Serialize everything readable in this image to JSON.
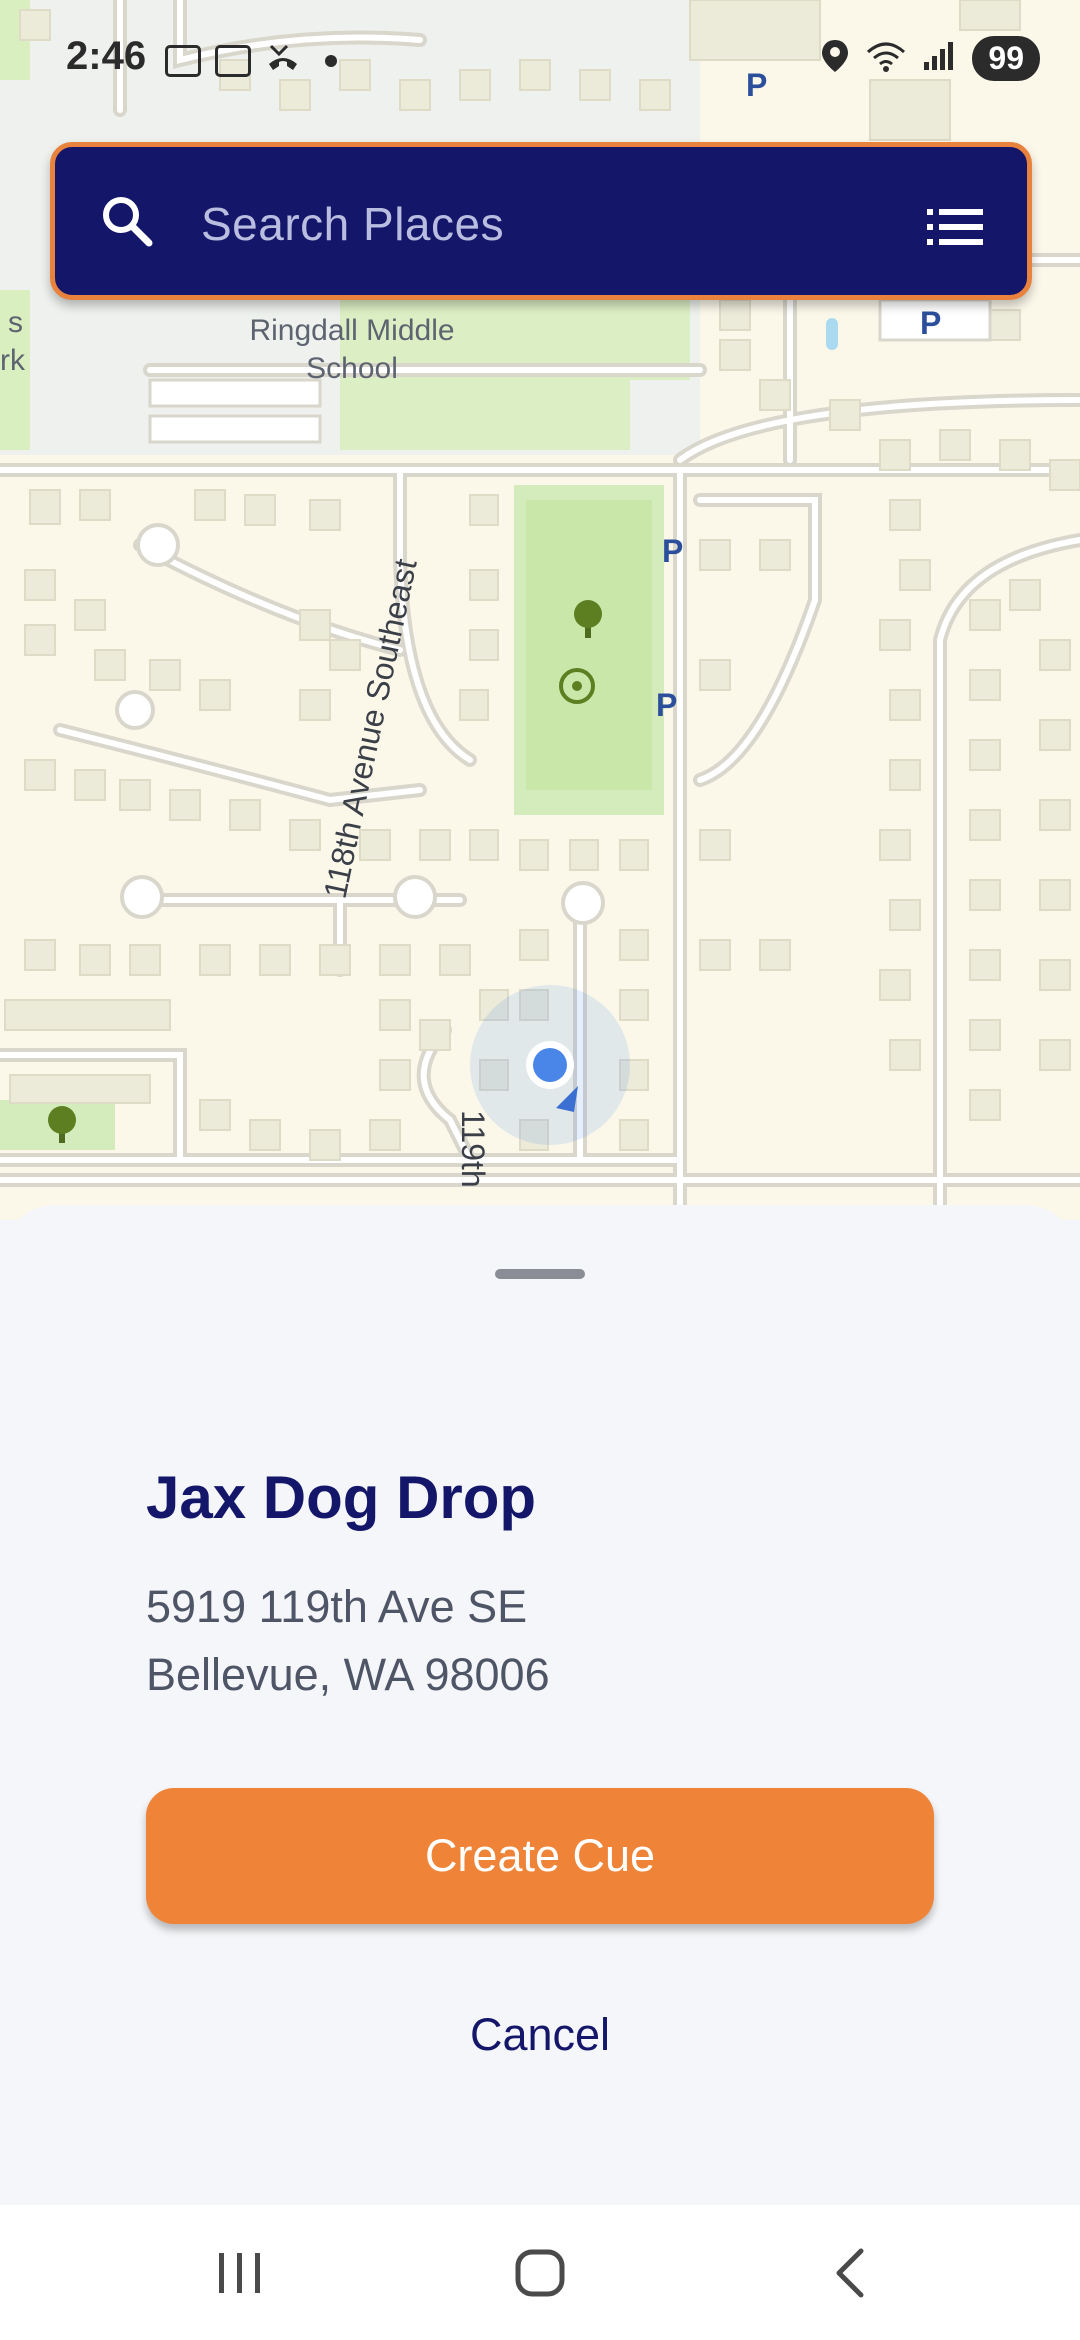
{
  "status_bar": {
    "time": "2:46",
    "battery": "99"
  },
  "search": {
    "placeholder": "Search Places"
  },
  "map": {
    "labels": {
      "school": "Ringdall Middle",
      "school_line2": "School",
      "street_118": "118th Avenue Southeast",
      "street_119": "119th",
      "parking": "P",
      "edge_s": "s",
      "edge_rk": "rk"
    }
  },
  "place": {
    "name": "Jax Dog Drop",
    "address_line1": "5919 119th Ave SE",
    "address_line2": "Bellevue, WA 98006"
  },
  "actions": {
    "create": "Create Cue",
    "cancel": "Cancel"
  },
  "colors": {
    "navy": "#14166a",
    "orange": "#ef8338",
    "map_bg": "#fbf8ea",
    "park": "#d9efbf",
    "location": "#4a86e8"
  }
}
